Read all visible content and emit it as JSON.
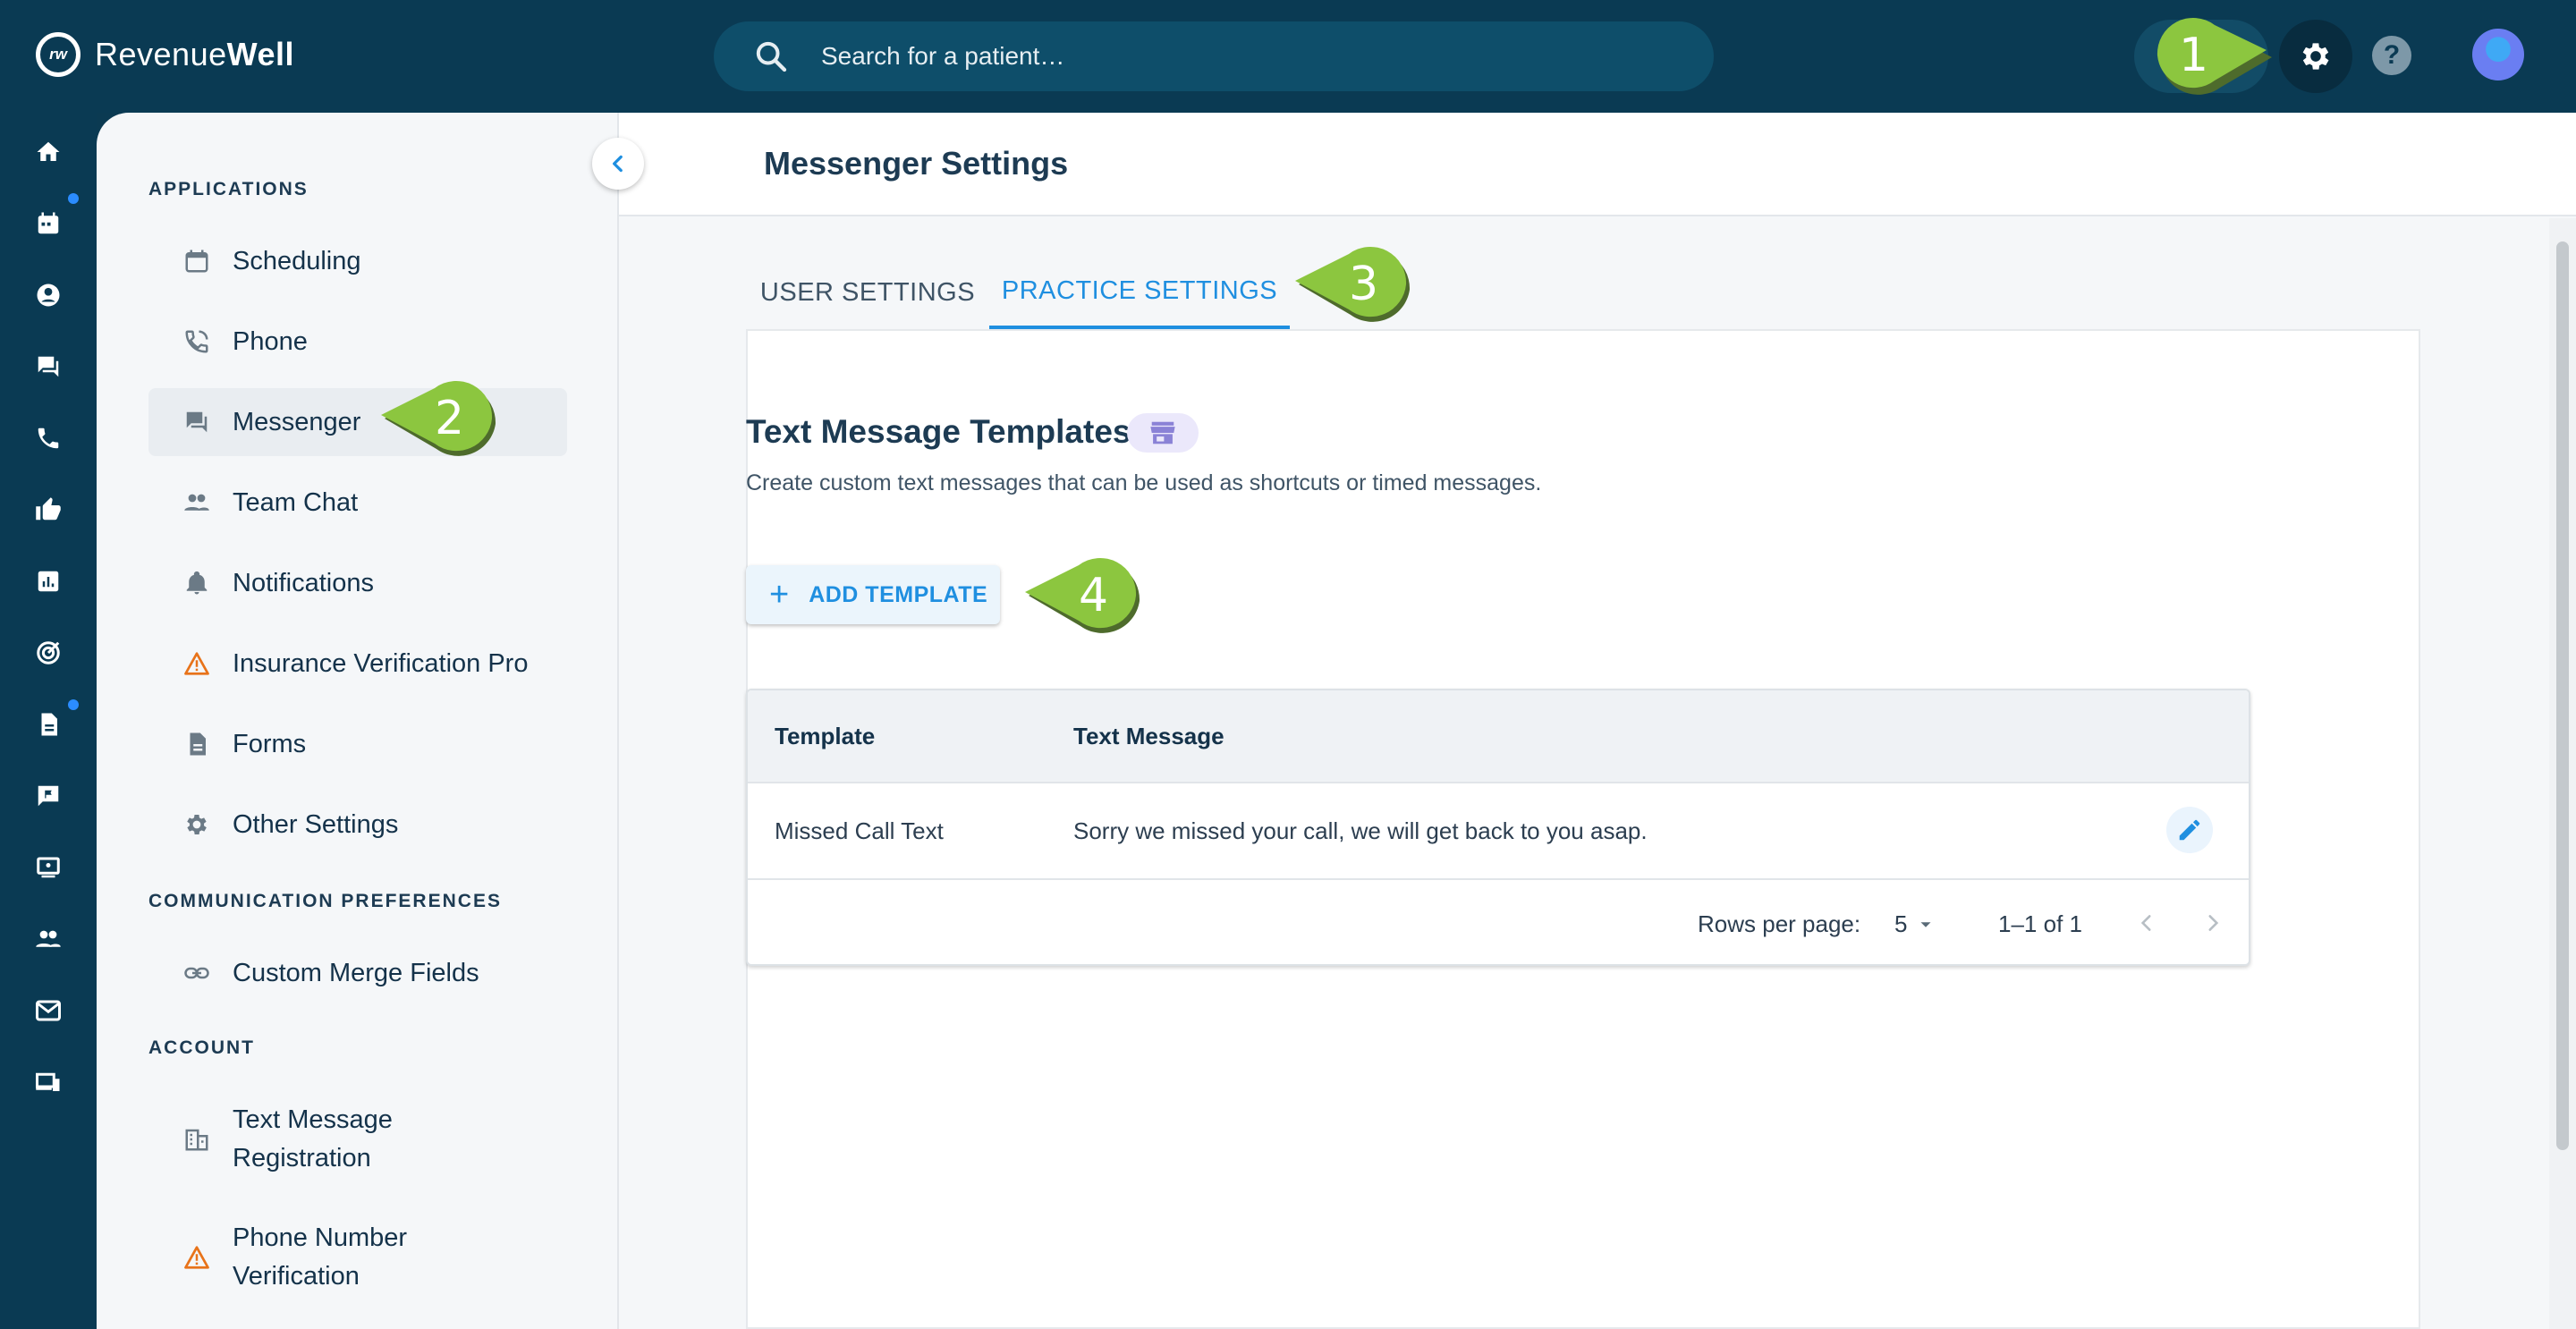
{
  "app": {
    "brand_light": "Revenue",
    "brand_bold": "Well",
    "logo_mark": "rw"
  },
  "search": {
    "placeholder": "Search for a patient…"
  },
  "topbar": {
    "help_label": "?"
  },
  "sidebar": {
    "sections": [
      {
        "label": "APPLICATIONS"
      },
      {
        "label": "COMMUNICATION PREFERENCES"
      },
      {
        "label": "ACCOUNT"
      }
    ],
    "items": [
      {
        "label": "Scheduling",
        "icon": "calendar-icon"
      },
      {
        "label": "Phone",
        "icon": "phone-icon"
      },
      {
        "label": "Messenger",
        "icon": "chat-icon",
        "active": true
      },
      {
        "label": "Team Chat",
        "icon": "people-icon"
      },
      {
        "label": "Notifications",
        "icon": "bell-icon"
      },
      {
        "label": "Insurance Verification Pro",
        "icon": "warning-icon"
      },
      {
        "label": "Forms",
        "icon": "document-icon"
      },
      {
        "label": "Other Settings",
        "icon": "gear-icon"
      },
      {
        "label": "Custom Merge Fields",
        "icon": "link-icon"
      },
      {
        "label_line1": "Text Message",
        "label_line2": "Registration",
        "icon": "building-icon"
      },
      {
        "label_line1": "Phone Number",
        "label_line2": "Verification",
        "icon": "warning-icon"
      }
    ]
  },
  "main": {
    "title": "Messenger Settings",
    "tabs": [
      {
        "label": "USER SETTINGS",
        "active": false
      },
      {
        "label": "PRACTICE SETTINGS",
        "active": true
      }
    ],
    "section_title": "Text Message Templates",
    "section_desc": "Create custom text messages that can be used as shortcuts or timed messages.",
    "add_button": "ADD TEMPLATE",
    "table": {
      "columns": [
        "Template",
        "Text Message"
      ],
      "rows": [
        {
          "template": "Missed Call Text",
          "message": "Sorry we missed your call, we will get back to you asap."
        }
      ],
      "rows_per_page_label": "Rows per page:",
      "rows_per_page_value": "5",
      "range": "1–1 of 1"
    }
  },
  "callouts": [
    "1",
    "2",
    "3",
    "4"
  ],
  "colors": {
    "topbar": "#0a3a53",
    "accent": "#1f8fe0",
    "callout": "#8cc63f",
    "warning": "#e8731a"
  }
}
